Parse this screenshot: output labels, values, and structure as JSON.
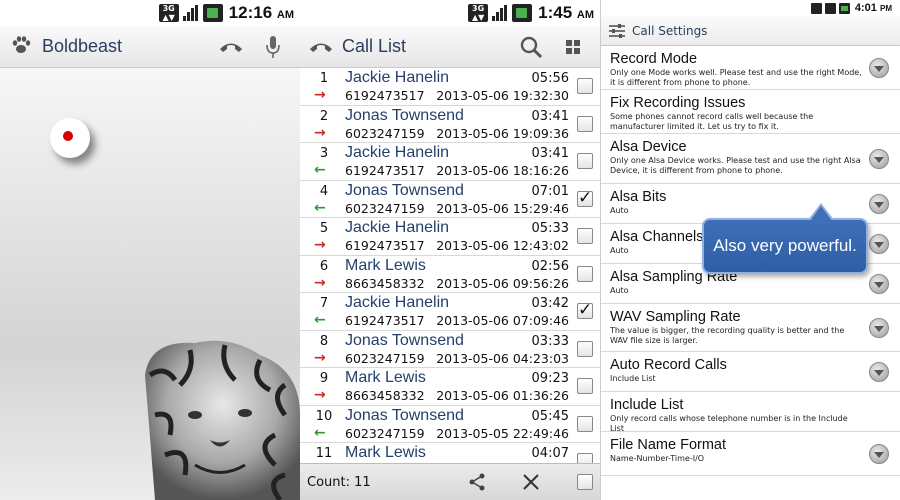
{
  "panel1": {
    "status": {
      "time": "12:16",
      "ampm": "AM",
      "network": "3G"
    },
    "title": "Boldbeast",
    "icons": [
      "paw-icon",
      "phone-handset-icon",
      "microphone-icon"
    ]
  },
  "panel2": {
    "status": {
      "time": "1:45",
      "ampm": "AM",
      "network": "3G"
    },
    "title": "Call List",
    "calls": [
      {
        "num": "1",
        "name": "Jackie Hanelin",
        "duration": "05:56",
        "phone": "6192473517",
        "datetime": "2013-05-06 19:32:30",
        "direction": "outgoing",
        "checked": false
      },
      {
        "num": "2",
        "name": "Jonas Townsend",
        "duration": "03:41",
        "phone": "6023247159",
        "datetime": "2013-05-06 19:09:36",
        "direction": "outgoing",
        "checked": false
      },
      {
        "num": "3",
        "name": "Jackie Hanelin",
        "duration": "03:41",
        "phone": "6192473517",
        "datetime": "2013-05-06 18:16:26",
        "direction": "incoming",
        "checked": false
      },
      {
        "num": "4",
        "name": "Jonas Townsend",
        "duration": "07:01",
        "phone": "6023247159",
        "datetime": "2013-05-06 15:29:46",
        "direction": "incoming",
        "checked": true
      },
      {
        "num": "5",
        "name": "Jackie Hanelin",
        "duration": "05:33",
        "phone": "6192473517",
        "datetime": "2013-05-06 12:43:02",
        "direction": "outgoing",
        "checked": false
      },
      {
        "num": "6",
        "name": "Mark Lewis",
        "duration": "02:56",
        "phone": "8663458332",
        "datetime": "2013-05-06 09:56:26",
        "direction": "outgoing",
        "checked": false
      },
      {
        "num": "7",
        "name": "Jackie Hanelin",
        "duration": "03:42",
        "phone": "6192473517",
        "datetime": "2013-05-06 07:09:46",
        "direction": "incoming",
        "checked": true
      },
      {
        "num": "8",
        "name": "Jonas Townsend",
        "duration": "03:33",
        "phone": "6023247159",
        "datetime": "2013-05-06 04:23:03",
        "direction": "outgoing",
        "checked": false
      },
      {
        "num": "9",
        "name": "Mark Lewis",
        "duration": "09:23",
        "phone": "8663458332",
        "datetime": "2013-05-06 01:36:26",
        "direction": "outgoing",
        "checked": false
      },
      {
        "num": "10",
        "name": "Jonas Townsend",
        "duration": "05:45",
        "phone": "6023247159",
        "datetime": "2013-05-05 22:49:46",
        "direction": "incoming",
        "checked": false
      },
      {
        "num": "11",
        "name": "Mark Lewis",
        "duration": "04:07",
        "phone": "",
        "datetime": "",
        "direction": "",
        "checked": false
      }
    ],
    "count_label": "Count: 11",
    "colors": {
      "outgoing": "#cc2a1d",
      "incoming": "#2e9a2e",
      "name": "#25406b"
    }
  },
  "panel3": {
    "status": {
      "time": "4:01",
      "ampm": "PM"
    },
    "title": "Call Settings",
    "settings": [
      {
        "title": "Record Mode",
        "desc": "Only one Mode works well. Please test and use the right Mode, it is different from phone to phone.",
        "dropdown": true
      },
      {
        "title": "Fix Recording Issues",
        "desc": "Some phones cannot record calls well because the manufacturer limited it. Let us try to fix it.",
        "dropdown": false
      },
      {
        "title": "Alsa Device",
        "desc": "Only one Alsa Device works. Please test and use the right Alsa Device, it is different from phone to phone.",
        "dropdown": true
      },
      {
        "title": "Alsa Bits",
        "desc": "Auto",
        "dropdown": true
      },
      {
        "title": "Alsa Channels",
        "desc": "Auto",
        "dropdown": true
      },
      {
        "title": "Alsa Sampling Rate",
        "desc": "Auto",
        "dropdown": true
      },
      {
        "title": "WAV Sampling Rate",
        "desc": "The value is bigger, the recording quality is better and the WAV file size is larger.",
        "dropdown": true
      },
      {
        "title": "Auto Record Calls",
        "desc": "Include List",
        "dropdown": true
      },
      {
        "title": "Include List",
        "desc": "Only record calls whose telephone number is in the Include List",
        "dropdown": false
      },
      {
        "title": "File Name Format",
        "desc": "Name-Number-Time-I/O",
        "dropdown": true
      }
    ],
    "callout": "Also very powerful."
  }
}
